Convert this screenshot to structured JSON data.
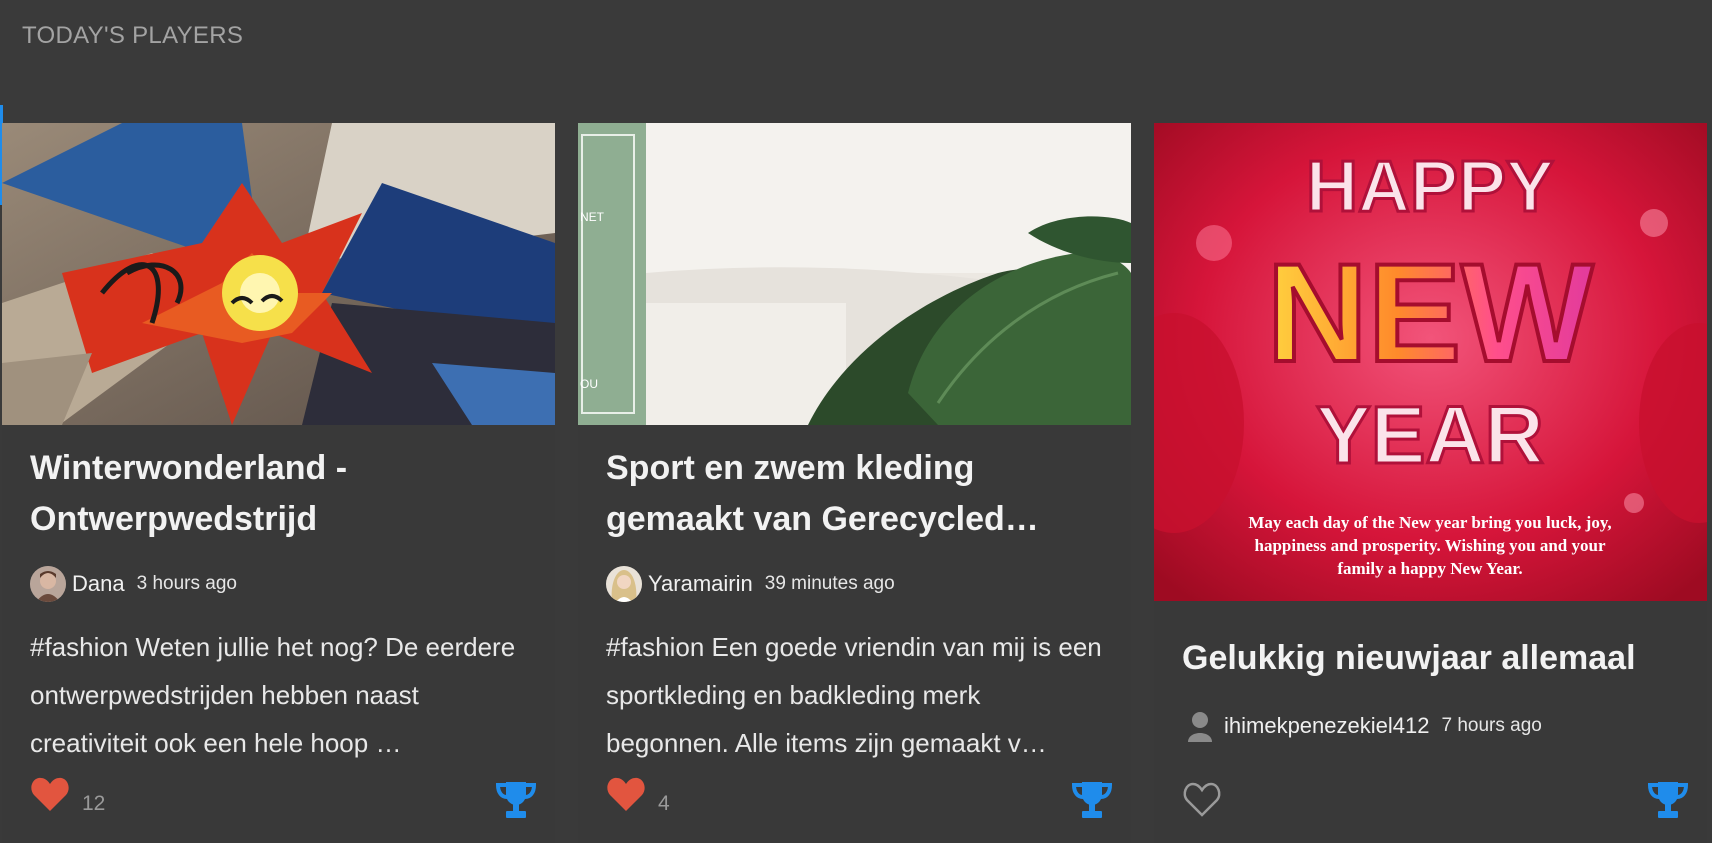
{
  "section": {
    "title": "TODAY'S PLAYERS"
  },
  "cards": [
    {
      "title": "Winterwonderland - Ontwerpwedstrijd",
      "user": "Dana",
      "time": "3 hours ago",
      "description": "#fashion  Weten jullie het nog? De eerdere ontwerpwedstrijden hebben naast creativiteit ook een hele hoop …",
      "likes": "12",
      "liked": true
    },
    {
      "title": "Sport en zwem kleding gemaakt van Gerecycled…",
      "user": "Yaramairin",
      "time": "39 minutes ago",
      "description": "#fashion Een goede vriendin van mij is een sportkleding en badkleding merk begonnen. Alle items zijn gemaakt v…",
      "likes": "4",
      "liked": true,
      "image_text": {
        "line1": "NET",
        "line2": "OU"
      }
    },
    {
      "title": "Gelukkig nieuwjaar allemaal",
      "user": "ihimekpenezekiel412",
      "time": "7 hours ago",
      "liked": false,
      "image_text": {
        "happy": "HAPPY",
        "new": "NEW",
        "year": "YEAR",
        "msg1": "May each day of the New year bring you luck, joy,",
        "msg2": "happiness and prosperity. Wishing you and your",
        "msg3": "family a happy New Year."
      }
    }
  ],
  "colors": {
    "heart": "#e2553f",
    "trophy": "#1f8ceb",
    "background": "#3a3a3a"
  },
  "icons": {
    "like": "heart-icon",
    "award": "trophy-icon",
    "avatar": "user-avatar"
  }
}
